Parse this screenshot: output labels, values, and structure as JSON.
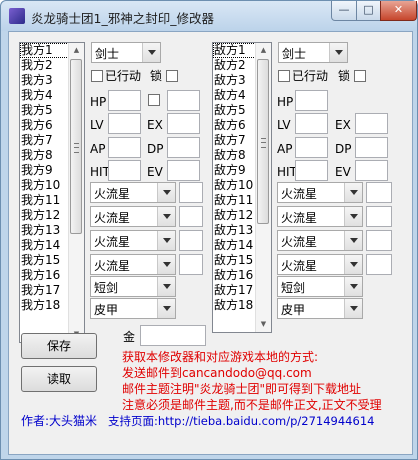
{
  "window": {
    "title": "炎龙骑士团1_邪神之封印_修改器",
    "min_label": "—",
    "max_label": "□",
    "close_label": "✕"
  },
  "our_list": {
    "items": [
      "我方1",
      "我方2",
      "我方3",
      "我方4",
      "我方5",
      "我方6",
      "我方7",
      "我方8",
      "我方9",
      "我方10",
      "我方11",
      "我方12",
      "我方13",
      "我方14",
      "我方15",
      "我方16",
      "我方17",
      "我方18"
    ]
  },
  "enemy_list": {
    "items": [
      "敌方1",
      "敌方2",
      "敌方3",
      "敌方4",
      "敌方5",
      "敌方6",
      "敌方7",
      "敌方8",
      "敌方9",
      "敌方10",
      "敌方11",
      "敌方12",
      "敌方13",
      "敌方14",
      "敌方15",
      "敌方16",
      "敌方17",
      "敌方18"
    ]
  },
  "our_panel": {
    "class_value": "剑士",
    "acted_label": "已行动",
    "lock_label": "锁",
    "stats": {
      "hp": "HP",
      "lv": "LV",
      "ex": "EX",
      "ap": "AP",
      "dp": "DP",
      "hit": "HIT",
      "ev": "EV"
    },
    "magic": [
      "火流星",
      "火流星",
      "火流星",
      "火流星"
    ],
    "weapon": "短剑",
    "armor": "皮甲"
  },
  "enemy_panel": {
    "class_value": "剑士",
    "acted_label": "已行动",
    "lock_label": "锁",
    "stats": {
      "hp": "HP",
      "lv": "LV",
      "ex": "EX",
      "ap": "AP",
      "dp": "DP",
      "hit": "HIT",
      "ev": "EV"
    },
    "magic": [
      "火流星",
      "火流星",
      "火流星",
      "火流星"
    ],
    "weapon": "短剑",
    "armor": "皮甲"
  },
  "gold_label": "金",
  "save_label": "保存",
  "load_label": "读取",
  "info_lines": [
    "获取本修改器和对应游戏本地的方式:",
    "发送邮件到cancandodo@qq.com",
    "邮件主题注明\"炎龙骑士团\"即可得到下载地址",
    "注意必须是邮件主题,而不是邮件正文,正文不受理"
  ],
  "footer": {
    "author": "作者:大头猫米",
    "support": "支持页面:http://tieba.baidu.com/p/2714944614"
  },
  "colors": {
    "info_text": "#e00000",
    "footer_text": "#0000cc"
  }
}
